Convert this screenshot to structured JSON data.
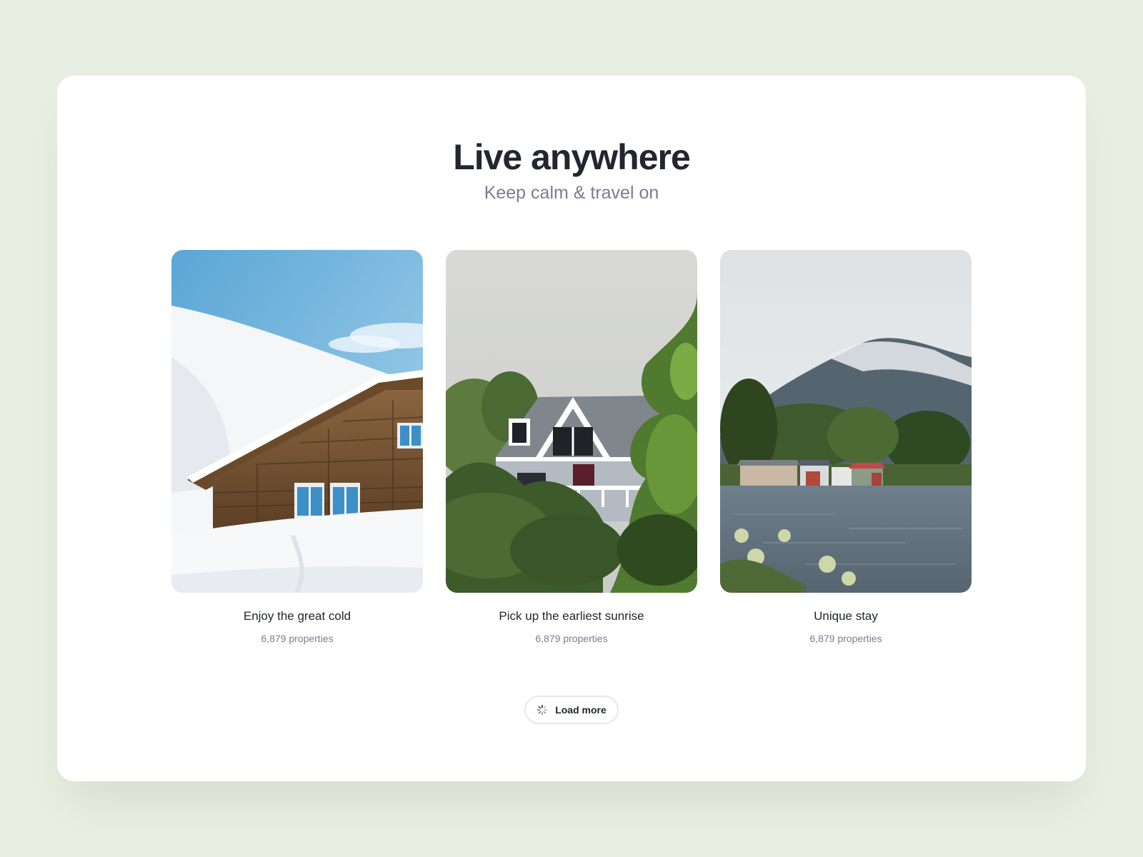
{
  "header": {
    "title": "Live anywhere",
    "subtitle": "Keep calm & travel on"
  },
  "categories": [
    {
      "title": "Enjoy the great cold",
      "count": "6,879 properties",
      "image": "snowy-chalet-photo"
    },
    {
      "title": "Pick up the earliest sunrise",
      "count": "6,879 properties",
      "image": "white-house-photo"
    },
    {
      "title": "Unique stay",
      "count": "6,879 properties",
      "image": "lake-boathouses-photo"
    }
  ],
  "actions": {
    "load_more_label": "Load more",
    "load_more_icon": "loading-spinner-icon"
  },
  "colors": {
    "background": "#e8eee1",
    "card": "#ffffff",
    "heading": "#23262f",
    "muted": "#777e90",
    "button_border": "#e6e8ec"
  }
}
